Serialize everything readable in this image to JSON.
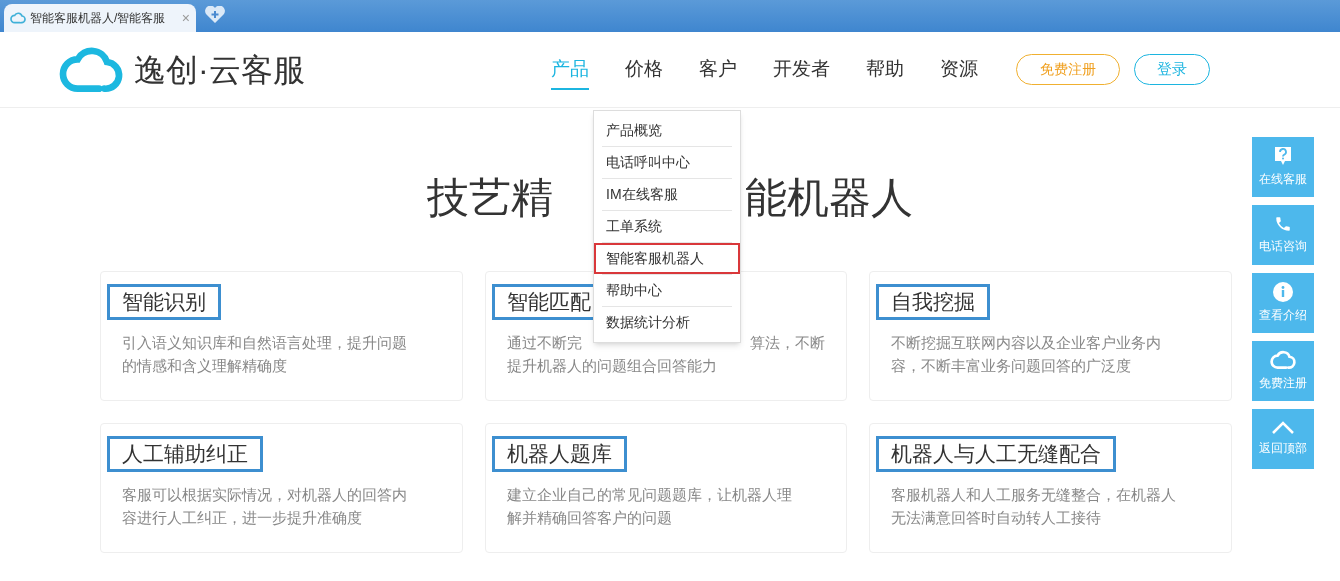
{
  "browser_tab": {
    "title": "智能客服机器人/智能客服",
    "close": "×"
  },
  "header": {
    "logo": "逸创·云客服",
    "nav": [
      {
        "label": "产品",
        "selected": true
      },
      {
        "label": "价格",
        "selected": false
      },
      {
        "label": "客户",
        "selected": false
      },
      {
        "label": "开发者",
        "selected": false
      },
      {
        "label": "帮助",
        "selected": false
      },
      {
        "label": "资源",
        "selected": false
      }
    ],
    "register_button": "免费注册",
    "login_button": "登录"
  },
  "dropdown": [
    {
      "label": "产品概览",
      "highlighted": false
    },
    {
      "label": "电话呼叫中心",
      "highlighted": false
    },
    {
      "label": "IM在线客服",
      "highlighted": false
    },
    {
      "label": "工单系统",
      "highlighted": false
    },
    {
      "label": "智能客服机器人",
      "highlighted": true
    },
    {
      "label": "帮助中心",
      "highlighted": false
    },
    {
      "label": "数据统计分析",
      "highlighted": false
    }
  ],
  "heading_parts": [
    "技艺精",
    "能机器人"
  ],
  "cards": [
    {
      "title": "智能识别",
      "lines": [
        [
          "引入语义知识库和自然语言处理，提升问题"
        ],
        [
          "的情感和含义理解精确度"
        ]
      ]
    },
    {
      "title": "智能匹配",
      "lines": [
        [
          "通过不断完",
          "算法，不断"
        ],
        [
          "提升机器人的问题组合回答能力"
        ]
      ]
    },
    {
      "title": "自我挖掘",
      "lines": [
        [
          "不断挖掘互联网内容以及企业客户业务内"
        ],
        [
          "容，不断丰富业务问题回答的广泛度"
        ]
      ]
    },
    {
      "title": "人工辅助纠正",
      "lines": [
        [
          "客服可以根据实际情况，对机器人的回答内"
        ],
        [
          "容进行人工纠正，进一步提升准确度"
        ]
      ]
    },
    {
      "title": "机器人题库",
      "lines": [
        [
          "建立企业自己的常见问题题库，让机器人理"
        ],
        [
          "解并精确回答客户的问题"
        ]
      ]
    },
    {
      "title": "机器人与人工无缝配合",
      "lines": [
        [
          "客服机器人和人工服务无缝整合，在机器人"
        ],
        [
          "无法满意回答时自动转人工接待"
        ]
      ]
    }
  ],
  "side_bar": [
    {
      "kind": "question",
      "label": "在线客服"
    },
    {
      "kind": "phone",
      "label": "电话咨询"
    },
    {
      "kind": "info",
      "label": "查看介绍"
    },
    {
      "kind": "cloud",
      "label": "免费注册"
    },
    {
      "kind": "up",
      "label": "返回顶部"
    }
  ]
}
